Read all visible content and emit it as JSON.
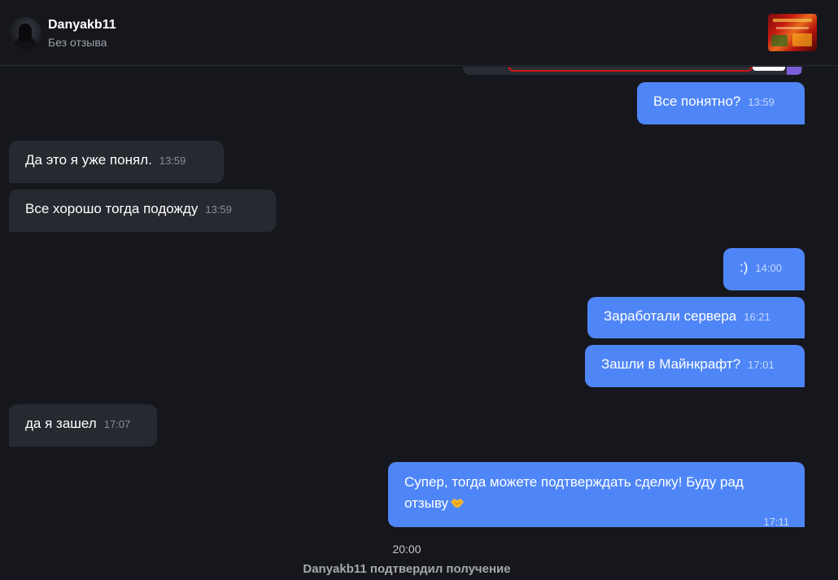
{
  "header": {
    "username": "Danyakb11",
    "status": "Без отзыва"
  },
  "messages": [
    {
      "direction": "out",
      "text": "Все понятно?",
      "time": "13:59"
    },
    {
      "direction": "in",
      "text": "Да это я уже понял.",
      "time": "13:59"
    },
    {
      "direction": "in",
      "text": "Все хорошо тогда подожду",
      "time": "13:59"
    },
    {
      "direction": "out",
      "text": ":)",
      "time": "14:00"
    },
    {
      "direction": "out",
      "text": "Заработали сервера",
      "time": "16:21"
    },
    {
      "direction": "out",
      "text": "Зашли в Майнкрафт?",
      "time": "17:01"
    },
    {
      "direction": "in",
      "text": "да я зашел",
      "time": "17:07"
    },
    {
      "direction": "out",
      "text": "Супер, тогда можете подтверждать сделку! Буду рад отзыву",
      "time": "17:11",
      "emoji": "handshake-icon"
    }
  ],
  "system": {
    "time": "20:00",
    "text": "Danyakb11 подтвердил получение"
  },
  "colors": {
    "background": "#16171c",
    "incoming_bubble": "#272930",
    "outgoing_bubble": "#4f86f7"
  }
}
